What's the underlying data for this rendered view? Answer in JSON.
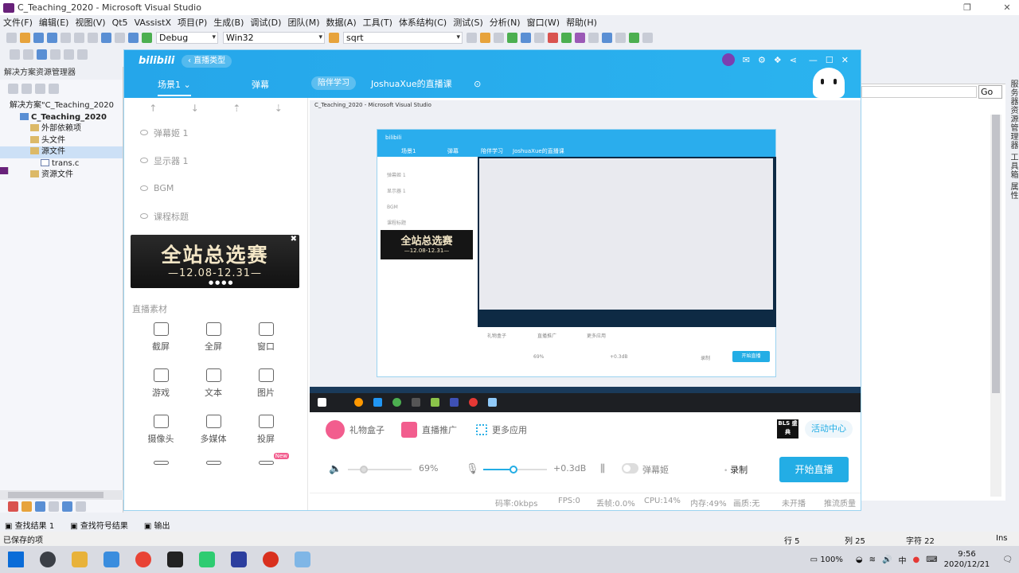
{
  "vs": {
    "title": "C_Teaching_2020 - Microsoft Visual Studio",
    "menu": [
      "文件(F)",
      "编辑(E)",
      "视图(V)",
      "Qt5",
      "VAssistX",
      "项目(P)",
      "生成(B)",
      "调试(D)",
      "团队(M)",
      "数据(A)",
      "工具(T)",
      "体系结构(C)",
      "测试(S)",
      "分析(N)",
      "窗口(W)",
      "帮助(H)"
    ],
    "config": "Debug",
    "platform": "Win32",
    "find": "sqrt",
    "solution_explorer_title": "解决方案资源管理器",
    "tree": [
      {
        "label": "解决方案\"C_Teaching_2020",
        "indent": 0,
        "icon": "solution"
      },
      {
        "label": "C_Teaching_2020",
        "indent": 1,
        "icon": "project"
      },
      {
        "label": "外部依赖项",
        "indent": 2,
        "icon": "folder"
      },
      {
        "label": "头文件",
        "indent": 2,
        "icon": "folder"
      },
      {
        "label": "源文件",
        "indent": 2,
        "icon": "folder"
      },
      {
        "label": "trans.c",
        "indent": 3,
        "icon": "file"
      },
      {
        "label": "资源文件",
        "indent": 2,
        "icon": "folder"
      }
    ],
    "go_button": "Go",
    "side_tabs": "服务器资源管理器 工具箱 属性",
    "output_tabs": [
      "查找结果 1",
      "查找符号结果",
      "输出"
    ],
    "status": {
      "left": "已保存的项",
      "row": "行 5",
      "col": "列 25",
      "char": "字符 22",
      "mode": "Ins"
    }
  },
  "bili": {
    "logo": "bilibili",
    "live_type": "直播类型",
    "scene_tab": "场景1",
    "danmaku_tab": "弹幕",
    "study_badge": "陪伴学习",
    "room_title": "JoshuaXue的直播课",
    "sources": [
      "弹幕姬 1",
      "显示器 1",
      "BGM",
      "课程标题"
    ],
    "banner": {
      "title": "全站总选赛",
      "dates": "—12.08-12.31—"
    },
    "materials_title": "直播素材",
    "materials": [
      {
        "label": "截屏",
        "icon": "crop-icon"
      },
      {
        "label": "全屏",
        "icon": "monitor-icon"
      },
      {
        "label": "窗口",
        "icon": "window-icon"
      },
      {
        "label": "游戏",
        "icon": "gamepad-icon"
      },
      {
        "label": "文本",
        "icon": "text-icon"
      },
      {
        "label": "图片",
        "icon": "image-icon"
      },
      {
        "label": "摄像头",
        "icon": "camera-icon"
      },
      {
        "label": "多媒体",
        "icon": "media-icon"
      },
      {
        "label": "投屏",
        "icon": "phone-icon"
      }
    ],
    "new_badge": "New",
    "apps": {
      "gift": "礼物盒子",
      "promote": "直播推广",
      "more": "更多应用"
    },
    "activity_logo": "BLS 盛典",
    "activity": "活动中心",
    "volume": "69%",
    "volume_fraction": 0.69,
    "mic_gain": "+0.3dB",
    "mic_fraction": 0.48,
    "danmaku_toggle": "弹幕姬",
    "record": "录制",
    "start_live": "开始直播",
    "status": {
      "bitrate": "码率:0kbps",
      "fps": "FPS:0",
      "drop": "丢帧:0.0%",
      "cpu": "CPU:14%",
      "mem": "内存:49%",
      "room": "画质:无",
      "stream": "未开播",
      "quality": "推流质量"
    }
  },
  "taskbar": {
    "battery": "100%",
    "ime": "中",
    "time": "9:56",
    "date": "2020/12/21"
  },
  "colors": {
    "bili_blue": "#23ade5",
    "vs_purple": "#68217a"
  }
}
